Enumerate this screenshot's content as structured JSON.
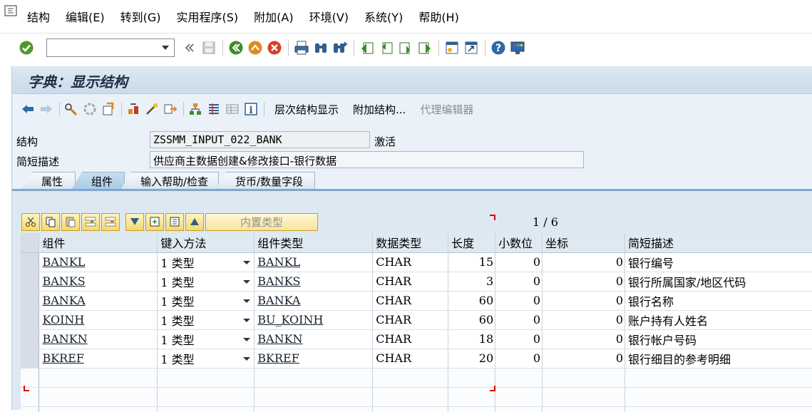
{
  "menubar": {
    "items": [
      "结构",
      "编辑(E)",
      "转到(G)",
      "实用程序(S)",
      "附加(A)",
      "环境(V)",
      "系统(Y)",
      "帮助(H)"
    ]
  },
  "toolbar": {
    "command_field_value": "",
    "icons": [
      "enter-icon",
      "back-icon",
      "save-icon",
      "back-nav-icon",
      "exit-icon",
      "cancel-icon",
      "print-icon",
      "find-icon",
      "find-next-icon",
      "first-page-icon",
      "previous-page-icon",
      "next-page-icon",
      "last-page-icon",
      "new-session-icon",
      "shortcut-icon",
      "help-icon",
      "customize-layout-icon"
    ]
  },
  "screen": {
    "title": "字典：显示结构"
  },
  "app_toolbar": {
    "hierarchy_display": "层次结构显示",
    "append_structure": "附加结构...",
    "proxy_editor": "代理编辑器"
  },
  "header_fields": {
    "structure_label": "结构",
    "structure_value": "ZSSMM_INPUT_022_BANK",
    "status": "激活",
    "short_desc_label": "简短描述",
    "short_desc_value": "供应商主数据创建&修改接口-银行数据"
  },
  "tabs": [
    "属性",
    "组件",
    "输入帮助/检查",
    "货币/数量字段"
  ],
  "active_tab": 1,
  "table_control": {
    "builtin_type_button": "内置类型",
    "pager": "1 / 6",
    "columns": [
      "组件",
      "键入方法",
      "组件类型",
      "数据类型",
      "长度",
      "小数位",
      "坐标",
      "简短描述"
    ],
    "rows": [
      {
        "component": "BANKL",
        "typing": "1 类型",
        "comp_type": "BANKL",
        "data_type": "CHAR",
        "length": "15",
        "decimals": "0",
        "coord": "0",
        "desc": "银行编号"
      },
      {
        "component": "BANKS",
        "typing": "1 类型",
        "comp_type": "BANKS",
        "data_type": "CHAR",
        "length": "3",
        "decimals": "0",
        "coord": "0",
        "desc": "银行所属国家/地区代码"
      },
      {
        "component": "BANKA",
        "typing": "1 类型",
        "comp_type": "BANKA",
        "data_type": "CHAR",
        "length": "60",
        "decimals": "0",
        "coord": "0",
        "desc": "银行名称"
      },
      {
        "component": "KOINH",
        "typing": "1 类型",
        "comp_type": "BU_KOINH",
        "data_type": "CHAR",
        "length": "60",
        "decimals": "0",
        "coord": "0",
        "desc": "账户持有人姓名"
      },
      {
        "component": "BANKN",
        "typing": "1 类型",
        "comp_type": "BANKN",
        "data_type": "CHAR",
        "length": "18",
        "decimals": "0",
        "coord": "0",
        "desc": "银行帐户号码"
      },
      {
        "component": "BKREF",
        "typing": "1 类型",
        "comp_type": "BKREF",
        "data_type": "CHAR",
        "length": "20",
        "decimals": "0",
        "coord": "0",
        "desc": "银行细目的参考明细"
      }
    ]
  },
  "colors": {
    "main_bg": "#eaf1f8",
    "title_color": "#1f2f43",
    "tab_active": "#aacbe7",
    "button_yellow": "#f6d96b",
    "corner_red": "#dd0000"
  }
}
